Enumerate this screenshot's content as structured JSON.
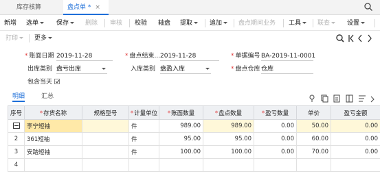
{
  "tabs": [
    {
      "label": "库存核算"
    },
    {
      "label": "盘点单 *",
      "close": "×"
    }
  ],
  "toolbar": {
    "items": [
      {
        "label": "新增",
        "enabled": true,
        "dropdown": false
      },
      {
        "label": "选单",
        "enabled": true,
        "dropdown": true
      },
      {
        "label": "保存",
        "enabled": true,
        "dropdown": true
      },
      {
        "label": "删除",
        "enabled": false,
        "dropdown": false
      },
      {
        "label": "审核",
        "enabled": false,
        "dropdown": false
      },
      {
        "label": "校验",
        "enabled": true,
        "dropdown": false
      },
      {
        "label": "轴盘",
        "enabled": true,
        "dropdown": false
      },
      {
        "label": "提取",
        "enabled": true,
        "dropdown": true
      },
      {
        "label": "追加",
        "enabled": true,
        "dropdown": true
      },
      {
        "label": "盘点期间业务",
        "enabled": false,
        "dropdown": false
      },
      {
        "label": "工具",
        "enabled": true,
        "dropdown": true
      },
      {
        "label": "联查",
        "enabled": false,
        "dropdown": true
      },
      {
        "label": "设置",
        "enabled": true,
        "dropdown": true
      }
    ]
  },
  "row2": {
    "print": "打印",
    "more": "更多"
  },
  "form": {
    "book_date_label": "账面日期",
    "book_date": "2019-11-28",
    "end_date_label": "盘点结束...",
    "end_date": "2019-11-28",
    "doc_no_label": "单据编号",
    "doc_no": "BA-2019-11-0001",
    "out_type_label": "出库类别",
    "out_type": "盘亏出库",
    "in_type_label": "入库类别",
    "in_type": "盘盈入库",
    "warehouse_label": "盘点仓库",
    "warehouse": "仓库",
    "include_today_label": "包含当天"
  },
  "subtabs": {
    "detail": "明细",
    "summary": "汇总"
  },
  "table": {
    "headers": [
      "序号",
      "存货名称",
      "规格型号",
      "计量单位",
      "账面数量",
      "盘点数量",
      "盈亏数量",
      "单价",
      "盈亏金额"
    ],
    "required": [
      false,
      true,
      false,
      true,
      true,
      true,
      true,
      false,
      false
    ],
    "rows": [
      {
        "no": "",
        "name": "李宁短袖",
        "spec": "",
        "unit": "件",
        "book_qty": "989.00",
        "count_qty": "989.00",
        "diff_qty": "0.00",
        "price": "50.00",
        "diff_amt": "0.00"
      },
      {
        "no": "2",
        "name": "361短袖",
        "spec": "",
        "unit": "件",
        "book_qty": "95.00",
        "count_qty": "95.00",
        "diff_qty": "0.00",
        "price": "60.00",
        "diff_amt": "0.00"
      },
      {
        "no": "3",
        "name": "安踏短袖",
        "spec": "",
        "unit": "件",
        "book_qty": "100.00",
        "count_qty": "100.00",
        "diff_qty": "0.00",
        "price": "70.00",
        "diff_amt": "0.00"
      },
      {
        "no": "4",
        "name": "",
        "spec": "",
        "unit": "",
        "book_qty": "",
        "count_qty": "",
        "diff_qty": "",
        "price": "",
        "diff_amt": ""
      }
    ]
  },
  "colors": {
    "accent": "#1e6fd9",
    "required": "#e13c3c",
    "row_highlight": "#fff8d9"
  }
}
